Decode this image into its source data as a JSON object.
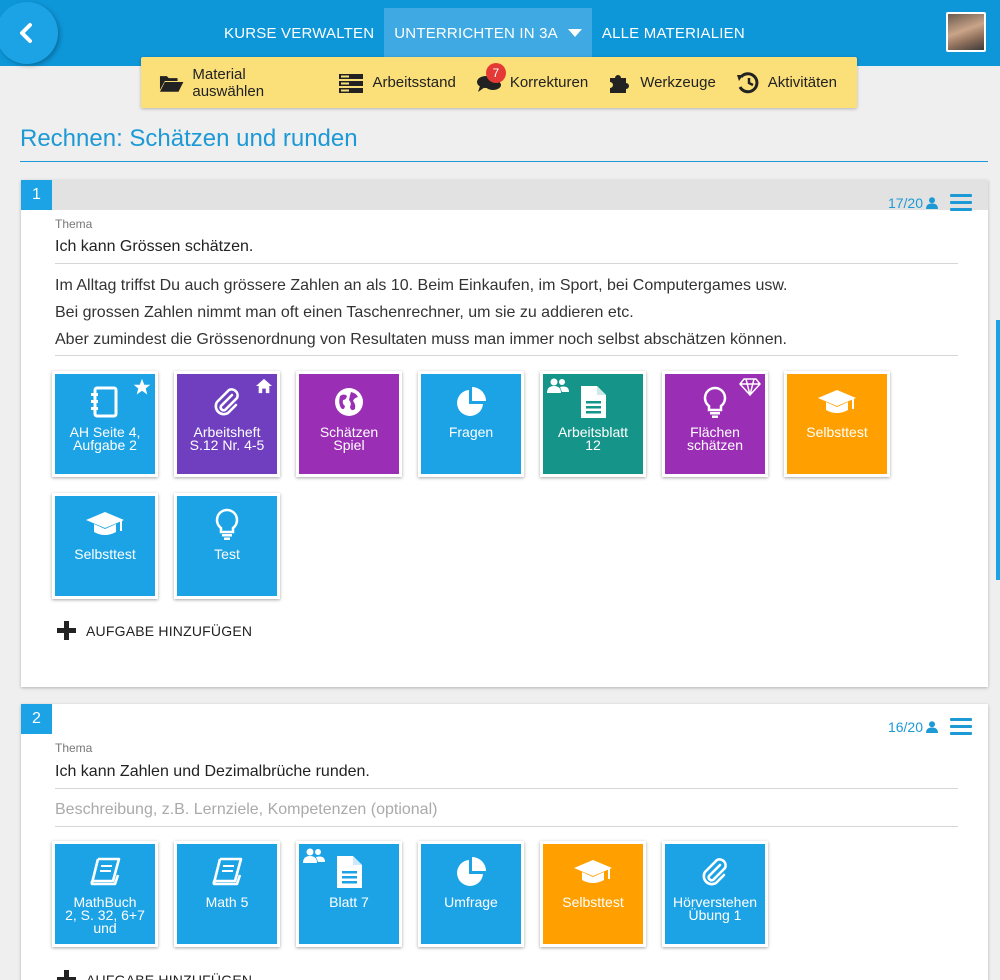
{
  "colors": {
    "blue": "#1ba3e6",
    "purple": "#9a2fb5",
    "violet": "#6f3fc0",
    "teal": "#15958a",
    "orange": "#ffa000",
    "toolbar": "#fbe07a"
  },
  "nav": {
    "tabs": [
      {
        "label": "KURSE VERWALTEN"
      },
      {
        "label": "UNTERRICHTEN IN 3A"
      },
      {
        "label": "ALLE MATERIALIEN"
      }
    ]
  },
  "toolbar": {
    "items": [
      {
        "label": "Material auswählen",
        "icon": "folder-open-icon"
      },
      {
        "label": "Arbeitsstand",
        "icon": "server-list-icon"
      },
      {
        "label": "Korrekturen",
        "icon": "comments-icon",
        "badge": "7"
      },
      {
        "label": "Werkzeuge",
        "icon": "puzzle-icon"
      },
      {
        "label": "Aktivitäten",
        "icon": "history-icon"
      }
    ]
  },
  "page": {
    "title": "Rechnen: Schätzen und runden"
  },
  "sections": [
    {
      "number": "1",
      "count": "17/20",
      "thema_label": "Thema",
      "thema": "Ich kann Grössen schätzen.",
      "description": [
        "Im Alltag triffst Du auch grössere Zahlen an als 10. Beim Einkaufen, im Sport, bei Computergames usw.",
        "Bei grossen Zahlen nimmt man oft einen Taschenrechner, um sie zu addieren etc.",
        "Aber zumindest die Grössenordnung von Resultaten muss man immer noch selbst abschätzen können."
      ],
      "tiles": [
        {
          "label": "AH Seite 4,\nAufgabe 2",
          "color": "#1ba3e6",
          "icon": "notebook-icon",
          "corner": "star-icon"
        },
        {
          "label": "Arbeitsheft\nS.12 Nr. 4-5",
          "color": "#6f3fc0",
          "icon": "paperclip-icon",
          "corner": "home-icon"
        },
        {
          "label": "Schätzen\nSpiel",
          "color": "#9a2fb5",
          "icon": "globe-icon"
        },
        {
          "label": "Fragen",
          "color": "#1ba3e6",
          "icon": "pie-chart-icon"
        },
        {
          "label": "Arbeitsblatt\n12",
          "color": "#15958a",
          "icon": "document-icon",
          "cornerl": "group-icon"
        },
        {
          "label": "Flächen\nschätzen",
          "color": "#9a2fb5",
          "icon": "lightbulb-icon",
          "corner": "diamond-icon"
        },
        {
          "label": "Selbsttest",
          "color": "#ffa000",
          "icon": "graduation-cap-icon"
        },
        {
          "label": "Selbsttest",
          "color": "#1ba3e6",
          "icon": "graduation-cap-icon"
        },
        {
          "label": "Test",
          "color": "#1ba3e6",
          "icon": "lightbulb-icon"
        }
      ],
      "add_label": "AUFGABE HINZUFÜGEN"
    },
    {
      "number": "2",
      "count": "16/20",
      "thema_label": "Thema",
      "thema": "Ich kann Zahlen und Dezimalbrüche runden.",
      "description_placeholder": "Beschreibung, z.B. Lernziele, Kompetenzen (optional)",
      "tiles": [
        {
          "label": "MathBuch\n2, S. 32, 6+7\nund",
          "color": "#1ba3e6",
          "icon": "book-icon"
        },
        {
          "label": "Math 5",
          "color": "#1ba3e6",
          "icon": "book-icon"
        },
        {
          "label": "Blatt 7",
          "color": "#1ba3e6",
          "icon": "document-icon",
          "cornerl": "group-icon"
        },
        {
          "label": "Umfrage",
          "color": "#1ba3e6",
          "icon": "pie-chart-icon"
        },
        {
          "label": "Selbsttest",
          "color": "#ffa000",
          "icon": "graduation-cap-icon"
        },
        {
          "label": "Hörverstehen\nÜbung 1",
          "color": "#1ba3e6",
          "icon": "paperclip-icon"
        }
      ],
      "add_label": "AUFGABE HINZUFÜGEN"
    }
  ]
}
